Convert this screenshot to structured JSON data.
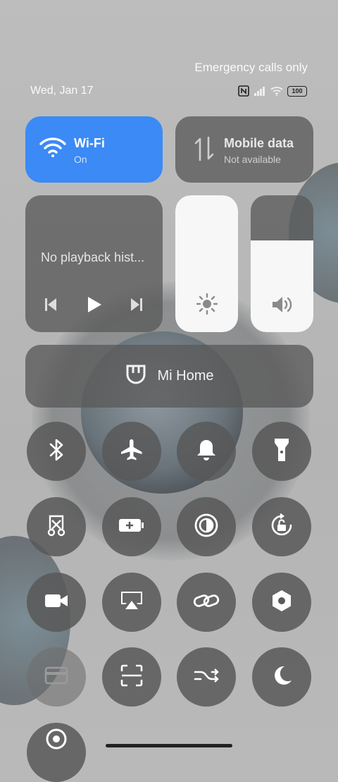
{
  "status": {
    "carrier_text": "Emergency calls only",
    "date": "Wed, Jan 17",
    "battery_level": "100",
    "icons": [
      "nfc-icon",
      "signal-icon",
      "wifi-icon",
      "battery-icon"
    ]
  },
  "tiles": {
    "wifi": {
      "title": "Wi-Fi",
      "subtitle": "On",
      "icon": "wifi-icon",
      "color": "#3b8af6"
    },
    "mobile_data": {
      "title": "Mobile data",
      "subtitle": "Not available",
      "icon": "mobile-data-icon"
    }
  },
  "media": {
    "text": "No playback hist...",
    "controls": [
      "previous-icon",
      "play-icon",
      "next-icon"
    ]
  },
  "sliders": {
    "brightness": {
      "level": 1.0,
      "icon": "brightness-icon"
    },
    "volume": {
      "level": 0.67,
      "icon": "volume-icon"
    }
  },
  "mi_home": {
    "label": "Mi Home",
    "icon": "mi-home-icon"
  },
  "toggles": [
    "bluetooth-icon",
    "airplane-icon",
    "bell-icon",
    "flashlight-icon",
    "screenshot-icon",
    "battery-saver-icon",
    "dark-mode-icon",
    "rotation-lock-icon",
    "screen-record-icon",
    "cast-icon",
    "link-icon",
    "settings-icon",
    "card-icon",
    "scan-icon",
    "swap-icon",
    "moon-icon",
    "location-icon"
  ]
}
